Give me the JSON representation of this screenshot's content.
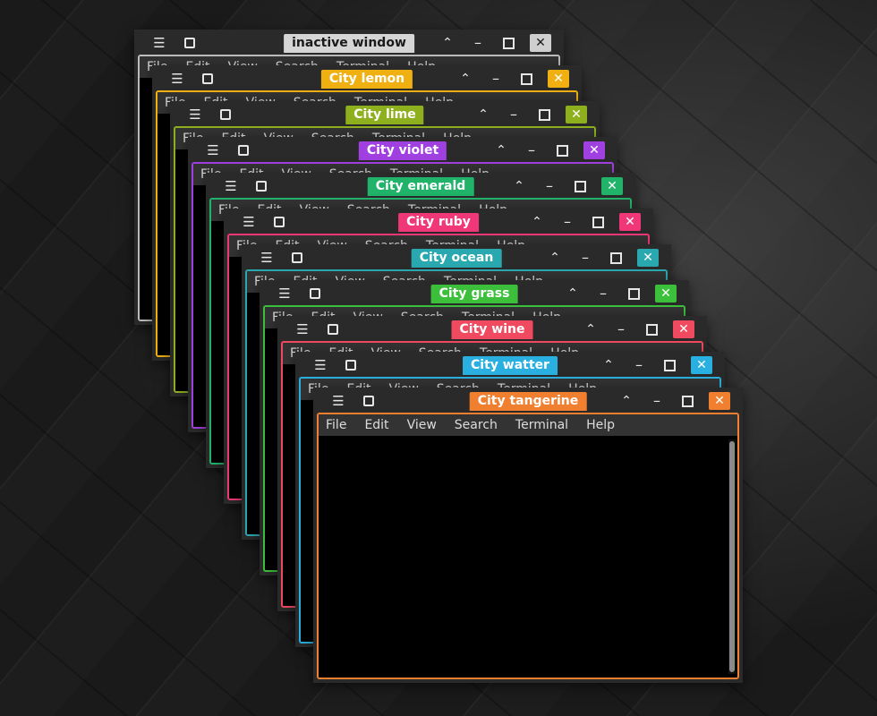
{
  "menu_items": [
    "File",
    "Edit",
    "View",
    "Search",
    "Terminal",
    "Help"
  ],
  "titlebar_icons": {
    "menu": "☰",
    "shade": "⌃",
    "minimize": "–",
    "close": "✕"
  },
  "windows": [
    {
      "title": "inactive window",
      "color": "#d6d6d6",
      "text_color": "#1a1a1a",
      "frame": "#bdbdbd",
      "close_bg": "#cfcfcf",
      "close_fg": "#1a1a1a"
    },
    {
      "title": "City lemon",
      "color": "#f0b012",
      "frame": "#f0b012"
    },
    {
      "title": "City lime",
      "color": "#8fb01e",
      "frame": "#8fb01e"
    },
    {
      "title": "City violet",
      "color": "#a040e0",
      "frame": "#a040e0"
    },
    {
      "title": "City emerald",
      "color": "#22b36b",
      "frame": "#22b36b"
    },
    {
      "title": "City ruby",
      "color": "#f03878",
      "frame": "#f03878"
    },
    {
      "title": "City ocean",
      "color": "#2aa8b0",
      "frame": "#2aa8b0"
    },
    {
      "title": "City grass",
      "color": "#3cc03c",
      "frame": "#3cc03c"
    },
    {
      "title": "City wine",
      "color": "#f04a60",
      "frame": "#f04a60"
    },
    {
      "title": "City watter",
      "color": "#2ab0e0",
      "frame": "#2ab0e0"
    },
    {
      "title": "City tangerine",
      "color": "#f08030",
      "frame": "#f08030"
    }
  ]
}
